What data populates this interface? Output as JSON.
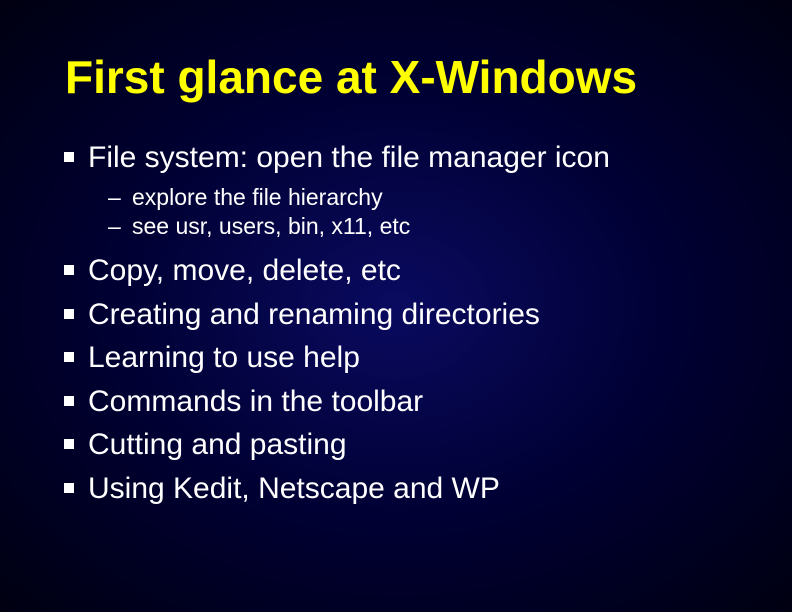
{
  "title": "First glance at X-Windows",
  "bullets": {
    "b0": "File system: open the file manager icon",
    "b0_sub0": "explore the file hierarchy",
    "b0_sub1": "see usr, users, bin, x11, etc",
    "b1": "Copy, move, delete, etc",
    "b2": "Creating and renaming directories",
    "b3": "Learning to use help",
    "b4": "Commands in the toolbar",
    "b5": "Cutting and pasting",
    "b6": "Using Kedit, Netscape and WP"
  }
}
